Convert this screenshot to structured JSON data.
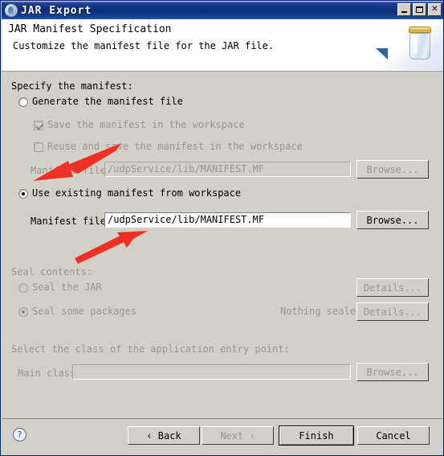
{
  "window": {
    "title": "JAR Export",
    "icon": "jar-export-icon",
    "controls": {
      "minimize": "minimize-button",
      "maximize": "maximize-button",
      "close": "✕"
    }
  },
  "header": {
    "title": "JAR Manifest Specification",
    "description": "Customize the manifest file for the JAR file.",
    "banner_icon": "jar-banner-icon"
  },
  "manifest_section": {
    "group_label": "Specify the manifest:",
    "generate_radio": {
      "label": "Generate the manifest file",
      "selected": false,
      "enabled": true
    },
    "save_checkbox": {
      "label": "Save the manifest in the workspace",
      "checked": true,
      "enabled": false
    },
    "reuse_checkbox": {
      "label": "Reuse and save the manifest in the workspace",
      "checked": false,
      "enabled": false
    },
    "generate_file_label": "Manifest file:",
    "generate_file_value": "/udpService/lib/MANIFEST.MF",
    "generate_browse_label": "Browse...",
    "use_existing_radio": {
      "label": "Use existing manifest from workspace",
      "selected": true,
      "enabled": true
    },
    "existing_file_label": "Manifest file:",
    "existing_file_value": "/udpService/lib/MANIFEST.MF",
    "existing_browse_label": "Browse..."
  },
  "seal_section": {
    "group_label": "Seal contents:",
    "seal_jar_radio": {
      "label": "Seal the JAR",
      "selected": false,
      "enabled": false
    },
    "seal_jar_details_label": "Details...",
    "seal_packages_radio": {
      "label": "Seal some packages",
      "selected": true,
      "enabled": false
    },
    "seal_status": "Nothing sealed",
    "seal_packages_details_label": "Details..."
  },
  "entry_point_section": {
    "group_label": "Select the class of the application entry point:",
    "main_class_label": "Main class:",
    "main_class_value": "",
    "main_class_browse_label": "Browse..."
  },
  "footer": {
    "help_label": "?",
    "back_label": "‹ Back",
    "next_label": "Next ›",
    "finish_label": "Finish",
    "cancel_label": "Cancel"
  },
  "annotations": {
    "arrow_one": "red-arrow-pointing-to-generate-manifest-file-field",
    "arrow_two": "red-arrow-pointing-to-existing-manifest-file-field",
    "color": "#ee3124"
  }
}
